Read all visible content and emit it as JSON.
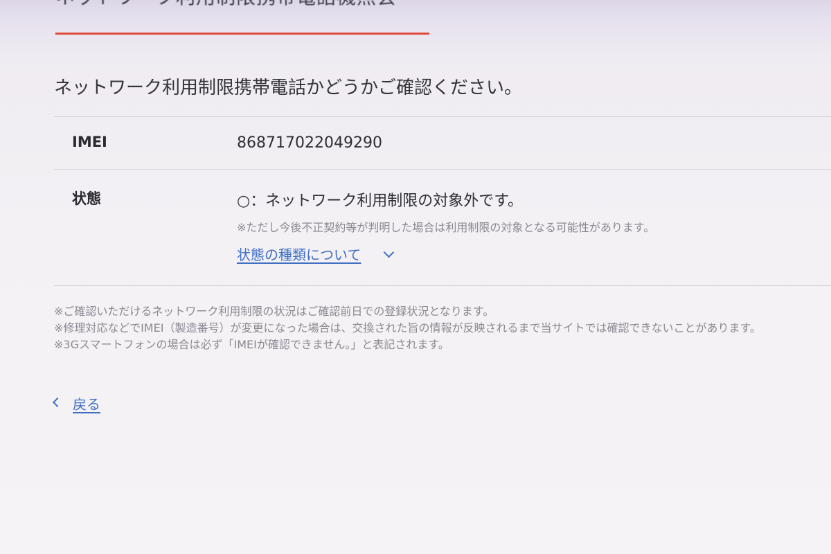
{
  "header": {
    "title": "ネットワーク利用制限携帯電話機照会"
  },
  "intro": "ネットワーク利用制限携帯電話かどうかご確認ください。",
  "result": {
    "imei_label": "IMEI",
    "imei_value": "868717022049290",
    "status_label": "状態",
    "status_value": "○：ネットワーク利用制限の対象外です。",
    "status_note": "※ただし今後不正契約等が判明した場合は利用制限の対象となる可能性があります。",
    "status_link": "状態の種類について"
  },
  "notes": [
    "※ご確認いただけるネットワーク利用制限の状況はご確認前日での登録状況となります。",
    "※修理対応などでIMEI（製造番号）が変更になった場合は、交換された旨の情報が反映されるまで当サイトでは確認できないことがあります。",
    "※3Gスマートフォンの場合は必ず「IMEIが確認できません。」と表記されます。"
  ],
  "back_label": "戻る",
  "colors": {
    "accent_underline": "#e0493a",
    "link": "#3f6fc4"
  }
}
